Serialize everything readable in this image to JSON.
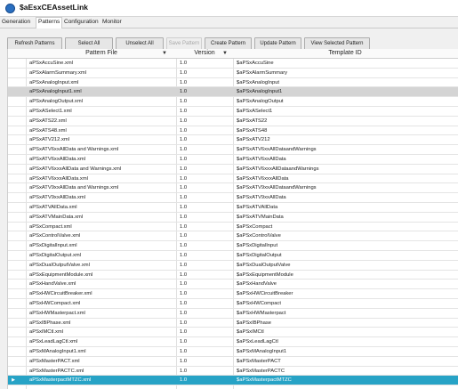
{
  "window": {
    "title": "$aEsxCEAssetLink"
  },
  "tabs": [
    {
      "label": "Generation",
      "active": false
    },
    {
      "label": "Patterns",
      "active": true
    },
    {
      "label": "Configuration",
      "active": false
    },
    {
      "label": "Monitor",
      "active": false
    }
  ],
  "toolbar": {
    "refresh_label": "Refresh Patterns",
    "select_all_label": "Select All",
    "unselect_all_label": "Unselect All",
    "save_label": "Save Pattern",
    "create_label": "Create Pattern",
    "update_label": "Update Pattern",
    "view_selected_label": "View Selected Pattern"
  },
  "grid": {
    "columns": [
      "Pattern File",
      "Version",
      "Template ID"
    ],
    "filter_symbol": "▼",
    "rows": [
      {
        "file": "aPSxAccuSine.xml",
        "version": "1.0",
        "template": "$aPSxAccuSine"
      },
      {
        "file": "aPSxAlarmSummary.xml",
        "version": "1.0",
        "template": "$aPSxAlarmSummary"
      },
      {
        "file": "aPSxAnalogInput.xml",
        "version": "1.0",
        "template": "$aPSxAnalogInput"
      },
      {
        "file": "aPSxAnalogInput1.xml",
        "version": "1.0",
        "template": "$aPSxAnalogInput1",
        "state": "selected"
      },
      {
        "file": "aPSxAnalogOutput.xml",
        "version": "1.0",
        "template": "$aPSxAnalogOutput"
      },
      {
        "file": "aPSxASelect1.xml",
        "version": "1.0",
        "template": "$aPSxASelect1"
      },
      {
        "file": "aPSxATS22.xml",
        "version": "1.0",
        "template": "$aPSxATS22"
      },
      {
        "file": "aPSxATS48.xml",
        "version": "1.0",
        "template": "$aPSxATS48"
      },
      {
        "file": "aPSxATV212.xml",
        "version": "1.0",
        "template": "$aPSxATV212"
      },
      {
        "file": "aPSxATV6xxAllData and Warnings.xml",
        "version": "1.0",
        "template": "$aPSxATV6xxAllDataandWarnings"
      },
      {
        "file": "aPSxATV6xxAllData.xml",
        "version": "1.0",
        "template": "$aPSxATV6xxAllData"
      },
      {
        "file": "aPSxATV6xxxAllData and Warnings.xml",
        "version": "1.0",
        "template": "$aPSxATV6xxxAllDataandWarnings"
      },
      {
        "file": "aPSxATV6xxxAllData.xml",
        "version": "1.0",
        "template": "$aPSxATV6xxxAllData"
      },
      {
        "file": "aPSxATV9xxAllData and Warnings.xml",
        "version": "1.0",
        "template": "$aPSxATV9xxAllDataandWarnings"
      },
      {
        "file": "aPSxATV9xxAllData.xml",
        "version": "1.0",
        "template": "$aPSxATV9xxAllData"
      },
      {
        "file": "aPSxATVAllData.xml",
        "version": "1.0",
        "template": "$aPSxATVAllData"
      },
      {
        "file": "aPSxATVMainData.xml",
        "version": "1.0",
        "template": "$aPSxATVMainData"
      },
      {
        "file": "aPSxCompact.xml",
        "version": "1.0",
        "template": "$aPSxCompact"
      },
      {
        "file": "aPSxControlValve.xml",
        "version": "1.0",
        "template": "$aPSxControlValve"
      },
      {
        "file": "aPSxDigitalInput.xml",
        "version": "1.0",
        "template": "$aPSxDigitalInput"
      },
      {
        "file": "aPSxDigitalOutput.xml",
        "version": "1.0",
        "template": "$aPSxDigitalOutput"
      },
      {
        "file": "aPSxDualOutputValve.xml",
        "version": "1.0",
        "template": "$aPSxDualOutputValve"
      },
      {
        "file": "aPSxEquipmentModule.xml",
        "version": "1.0",
        "template": "$aPSxEquipmentModule"
      },
      {
        "file": "aPSxHandValve.xml",
        "version": "1.0",
        "template": "$aPSxHandValve"
      },
      {
        "file": "aPSxHWCircuitBreaker.xml",
        "version": "1.0",
        "template": "$aPSxHWCircuitBreaker"
      },
      {
        "file": "aPSxHWCompact.xml",
        "version": "1.0",
        "template": "$aPSxHWCompact"
      },
      {
        "file": "aPSxHWMasterpact.xml",
        "version": "1.0",
        "template": "$aPSxHWMasterpact"
      },
      {
        "file": "aPSxIBPhase.xml",
        "version": "1.0",
        "template": "$aPSxIBPhase"
      },
      {
        "file": "aPSxIMCtl.xml",
        "version": "1.0",
        "template": "$aPSxIMCtl"
      },
      {
        "file": "aPSxLeadLagCtl.xml",
        "version": "1.0",
        "template": "$aPSxLeadLagCtl"
      },
      {
        "file": "aPSxMAnalogInput1.xml",
        "version": "1.0",
        "template": "$aPSxMAnalogInput1"
      },
      {
        "file": "aPSxMasterPACT.xml",
        "version": "1.0",
        "template": "$aPSxMasterPACT"
      },
      {
        "file": "aPSxMasterPACTC.xml",
        "version": "1.0",
        "template": "$aPSxMasterPACTC"
      },
      {
        "file": "aPSxMasterpactMTZC.xml",
        "version": "1.0",
        "template": "$aPSxMasterpactMTZC",
        "state": "active"
      }
    ]
  },
  "colors": {
    "accent": "#27a3c6",
    "selected_row": "#d4d4d4"
  }
}
